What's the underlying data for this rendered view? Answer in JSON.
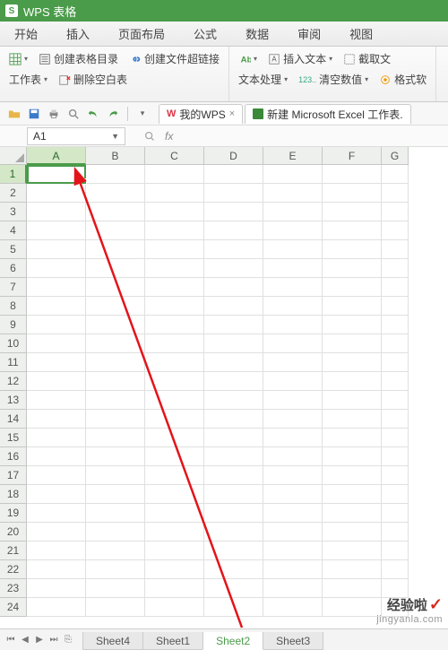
{
  "app": {
    "name": "WPS 表格"
  },
  "menus": [
    "开始",
    "插入",
    "页面布局",
    "公式",
    "数据",
    "审阅",
    "视图"
  ],
  "ribbon": {
    "group1": {
      "r1a": "创建表格目录",
      "r1b": "创建文件超链接",
      "r2a": "工作表",
      "r2b": "删除空白表"
    },
    "group2": {
      "r1a": "插入文本",
      "r1b": "截取文",
      "r2a": "文本处理",
      "r2b": "清空数值",
      "r2c": "格式软"
    }
  },
  "doctabs": {
    "t1": "我的WPS",
    "t2": "新建 Microsoft Excel 工作表."
  },
  "namebox": "A1",
  "fx_label": "fx",
  "cols": [
    "A",
    "B",
    "C",
    "D",
    "E",
    "F",
    "G"
  ],
  "rows": [
    "1",
    "2",
    "3",
    "4",
    "5",
    "6",
    "7",
    "8",
    "9",
    "10",
    "11",
    "12",
    "13",
    "14",
    "15",
    "16",
    "17",
    "18",
    "19",
    "20",
    "21",
    "22",
    "23",
    "24"
  ],
  "sheets": [
    "Sheet4",
    "Sheet1",
    "Sheet2",
    "Sheet3"
  ],
  "active_sheet": "Sheet2",
  "watermark": {
    "text": "经验啦",
    "url": "jingyanla.com"
  }
}
